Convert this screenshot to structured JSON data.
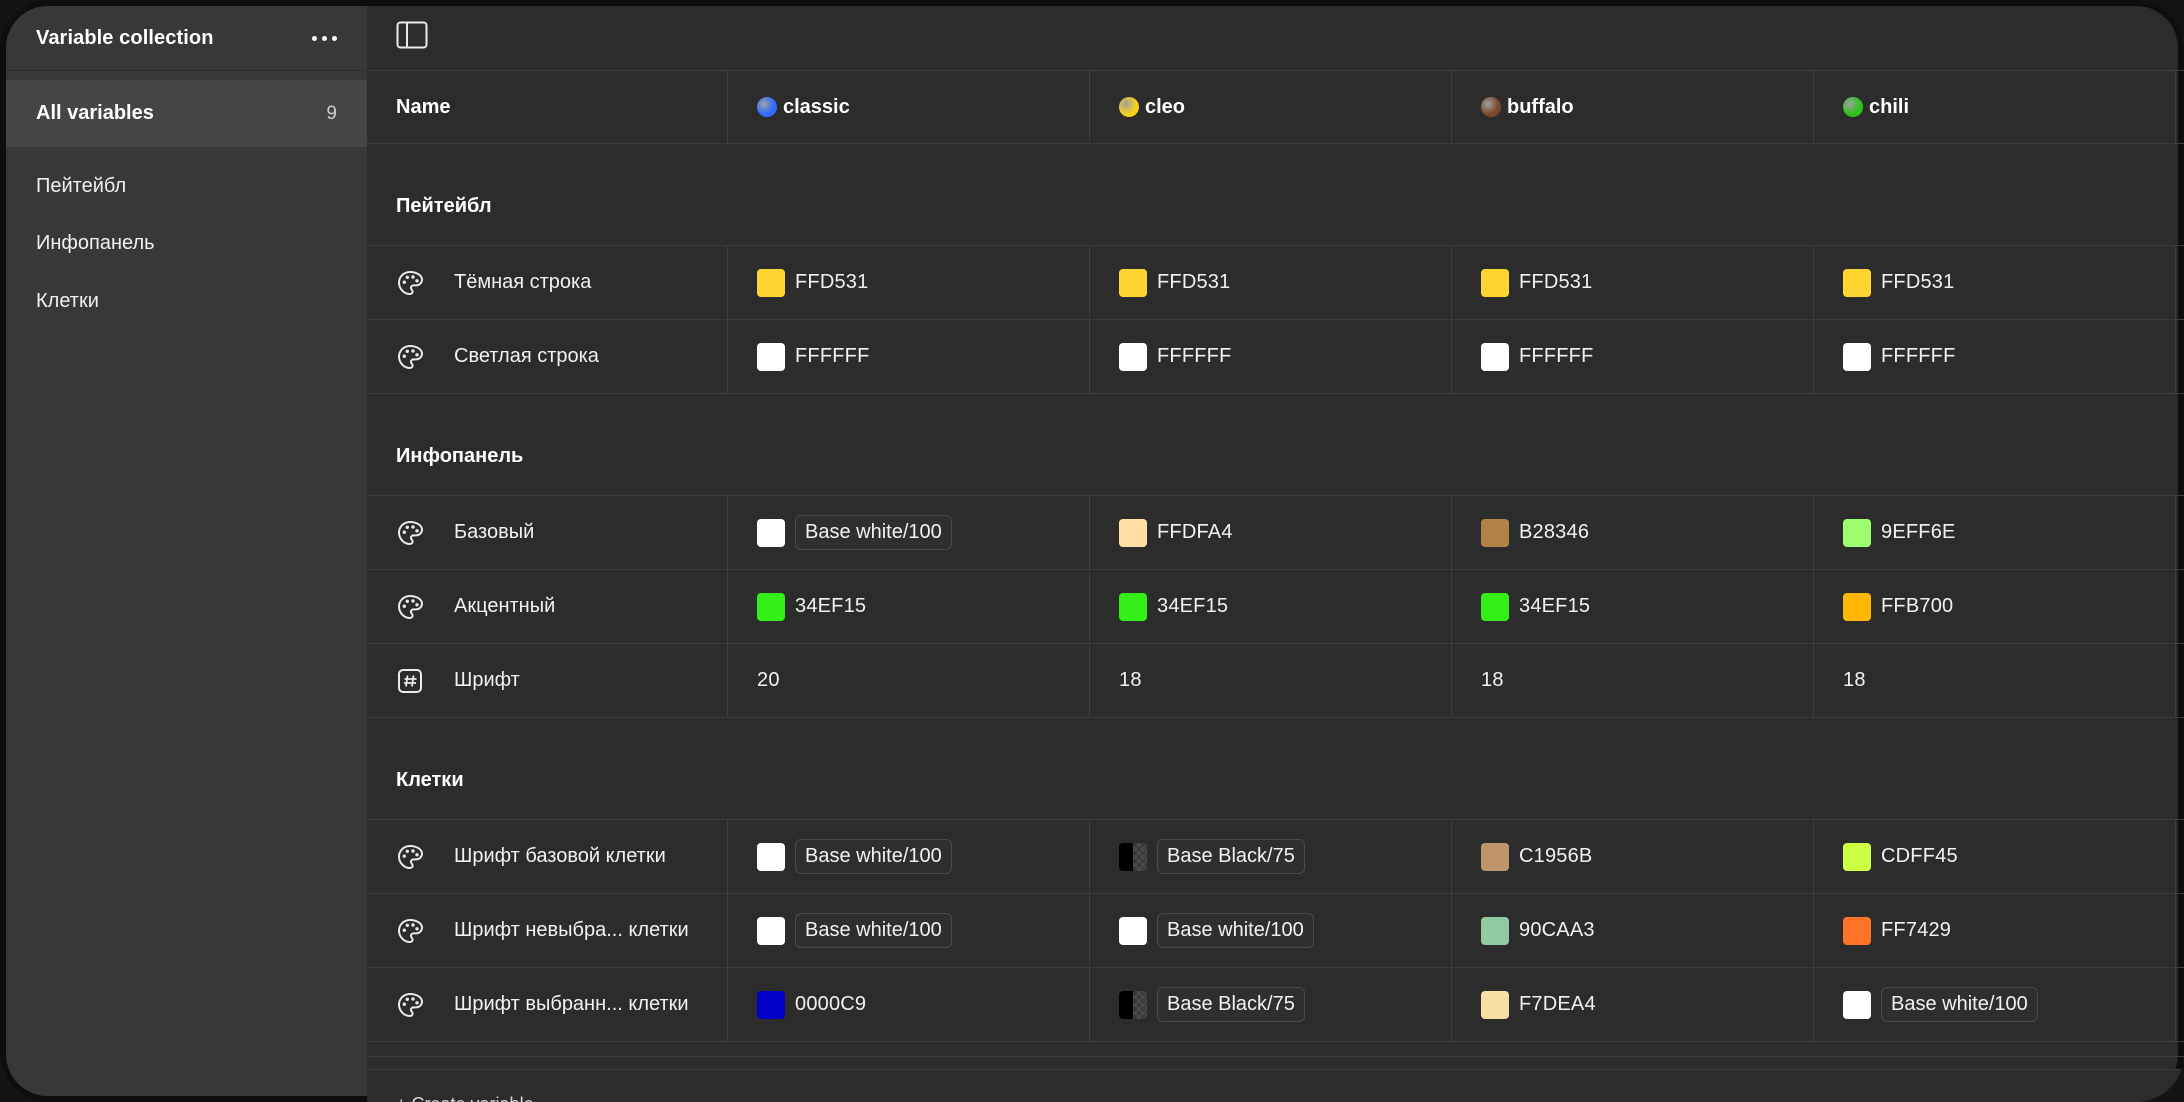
{
  "sidebar": {
    "title": "Variable collection",
    "all": {
      "label": "All variables",
      "count": "9"
    },
    "groups": [
      "Пейтейбл",
      "Инфопанель",
      "Клетки"
    ]
  },
  "table": {
    "name_header": "Name",
    "modes": [
      {
        "label": "classic",
        "dot_color": "#2f6bff"
      },
      {
        "label": "cleo",
        "dot_color": "#f4d21b"
      },
      {
        "label": "buffalo",
        "dot_color": "#7a4a2a"
      },
      {
        "label": "chili",
        "dot_color": "#2ec31b"
      }
    ],
    "groups": [
      {
        "title": "Пейтейбл",
        "rows": [
          {
            "name": "Тёмная строка",
            "icon": "palette-icon",
            "values": [
              {
                "swatch": "#FFD531",
                "text": "FFD531"
              },
              {
                "swatch": "#FFD531",
                "text": "FFD531"
              },
              {
                "swatch": "#FFD531",
                "text": "FFD531"
              },
              {
                "swatch": "#FFD531",
                "text": "FFD531"
              }
            ]
          },
          {
            "name": "Светлая строка",
            "icon": "palette-icon",
            "values": [
              {
                "swatch": "#FFFFFF",
                "text": "FFFFFF"
              },
              {
                "swatch": "#FFFFFF",
                "text": "FFFFFF"
              },
              {
                "swatch": "#FFFFFF",
                "text": "FFFFFF"
              },
              {
                "swatch": "#FFFFFF",
                "text": "FFFFFF"
              }
            ]
          }
        ]
      },
      {
        "title": "Инфопанель",
        "rows": [
          {
            "name": "Базовый",
            "icon": "palette-icon",
            "values": [
              {
                "swatch": "#FFFFFF",
                "alias": "Base white/100"
              },
              {
                "swatch": "#FFDFA4",
                "text": "FFDFA4"
              },
              {
                "swatch": "#B28346",
                "text": "B28346"
              },
              {
                "swatch": "#9EFF6E",
                "text": "9EFF6E"
              }
            ]
          },
          {
            "name": "Акцентный",
            "icon": "palette-icon",
            "values": [
              {
                "swatch": "#34EF15",
                "text": "34EF15"
              },
              {
                "swatch": "#34EF15",
                "text": "34EF15"
              },
              {
                "swatch": "#34EF15",
                "text": "34EF15"
              },
              {
                "swatch": "#FFB700",
                "text": "FFB700"
              }
            ]
          },
          {
            "name": "Шрифт",
            "icon": "number-icon",
            "values": [
              {
                "text": "20"
              },
              {
                "text": "18"
              },
              {
                "text": "18"
              },
              {
                "text": "18"
              }
            ]
          }
        ]
      },
      {
        "title": "Клетки",
        "rows": [
          {
            "name": "Шрифт базовой клетки",
            "icon": "palette-icon",
            "values": [
              {
                "swatch": "#FFFFFF",
                "alias": "Base white/100"
              },
              {
                "swatch": "black75",
                "alias": "Base Black/75"
              },
              {
                "swatch": "#C1956B",
                "text": "C1956B"
              },
              {
                "swatch": "#CDFF45",
                "text": "CDFF45"
              }
            ]
          },
          {
            "name": "Шрифт невыбра... клетки",
            "icon": "palette-icon",
            "values": [
              {
                "swatch": "#FFFFFF",
                "alias": "Base white/100"
              },
              {
                "swatch": "#FFFFFF",
                "alias": "Base white/100"
              },
              {
                "swatch": "#90CAA3",
                "text": "90CAA3"
              },
              {
                "swatch": "#FF7429",
                "text": "FF7429"
              }
            ]
          },
          {
            "name": "Шрифт выбранн... клетки",
            "icon": "palette-icon",
            "values": [
              {
                "swatch": "#0000C9",
                "text": "0000C9"
              },
              {
                "swatch": "black75",
                "alias": "Base Black/75"
              },
              {
                "swatch": "#F7DEA4",
                "text": "F7DEA4"
              },
              {
                "swatch": "#FFFFFF",
                "alias": "Base white/100"
              }
            ]
          }
        ]
      }
    ]
  },
  "footer": {
    "create_label": "+ Create variable"
  }
}
